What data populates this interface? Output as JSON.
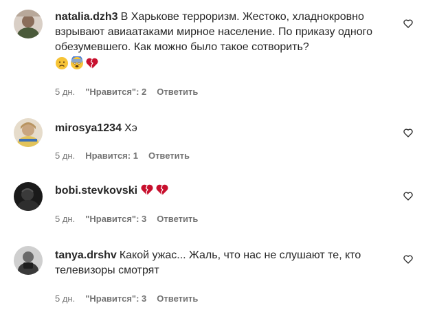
{
  "comments": [
    {
      "username": "natalia.dzh3",
      "text": "В Харькове терроризм. Жестоко, хладнокровно взрывают авиаатаками мирное население. По приказу одного обезумевшего. Как можно было такое сотворить?",
      "emojis": [
        "disappointed-face-icon",
        "fearful-face-icon",
        "broken-heart-icon"
      ],
      "time": "5 дн.",
      "likes": "\"Нравится\": 2",
      "reply": "Ответить",
      "avatar_color": "#8a6d5a"
    },
    {
      "username": "mirosya1234",
      "text": "Хэ",
      "emojis": [],
      "time": "5 дн.",
      "likes": "Нравится: 1",
      "reply": "Ответить",
      "avatar_color": "#c9b07a"
    },
    {
      "username": "bobi.stevkovski",
      "text": "",
      "emojis": [
        "broken-heart-icon",
        "broken-heart-icon"
      ],
      "time": "5 дн.",
      "likes": "\"Нравится\": 3",
      "reply": "Ответить",
      "avatar_color": "#2a2a2a"
    },
    {
      "username": "tanya.drshv",
      "text": "Какой ужас... Жаль, что нас не слушают те, кто телевизоры смотрят",
      "emojis": [],
      "time": "5 дн.",
      "likes": "\"Нравится\": 3",
      "reply": "Ответить",
      "avatar_color": "#5a5a5a"
    }
  ],
  "colors": {
    "text": "#262626",
    "secondary": "#737373",
    "heart_red": "#d0021b"
  }
}
